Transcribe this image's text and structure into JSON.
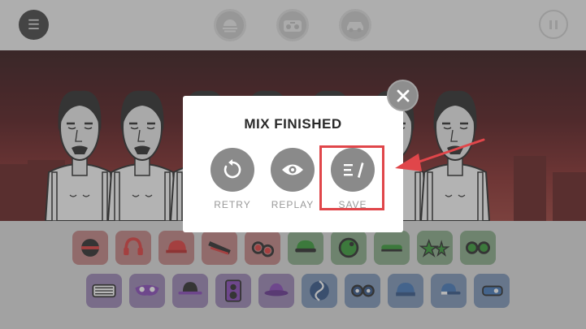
{
  "topbar": {
    "menu_icon": "hamburger-icon",
    "modes": [
      {
        "icon": "sunset-icon"
      },
      {
        "icon": "boombox-icon"
      },
      {
        "icon": "car-icon"
      }
    ],
    "pause_icon": "pause-icon"
  },
  "scene": {
    "characters": 7,
    "colors": {
      "sky_top": "#2a0d0f",
      "sky_bottom": "#8e3530",
      "building": "#5a1a1a"
    }
  },
  "palette": {
    "row1": [
      {
        "icon": "helmet-icon",
        "group": "red"
      },
      {
        "icon": "headphones-icon",
        "group": "red"
      },
      {
        "icon": "cap-icon",
        "group": "red"
      },
      {
        "icon": "sunglasses-icon",
        "group": "red"
      },
      {
        "icon": "round-glasses-icon",
        "group": "red"
      },
      {
        "icon": "green-cap-icon",
        "group": "green"
      },
      {
        "icon": "green-ball-icon",
        "group": "green"
      },
      {
        "icon": "green-headband-icon",
        "group": "green"
      },
      {
        "icon": "star-glasses-icon",
        "group": "green"
      },
      {
        "icon": "goggles-icon",
        "group": "green"
      }
    ],
    "row2": [
      {
        "icon": "shutter-glasses-icon",
        "group": "purple"
      },
      {
        "icon": "mask-icon",
        "group": "purple"
      },
      {
        "icon": "bowler-hat-icon",
        "group": "purple"
      },
      {
        "icon": "speaker-icon",
        "group": "purple"
      },
      {
        "icon": "fedora-icon",
        "group": "purple"
      },
      {
        "icon": "swirl-icon",
        "group": "blue"
      },
      {
        "icon": "blue-glasses-icon",
        "group": "blue"
      },
      {
        "icon": "blue-beanie-icon",
        "group": "blue"
      },
      {
        "icon": "blue-cap-icon",
        "group": "blue"
      },
      {
        "icon": "blue-visor-icon",
        "group": "blue"
      }
    ]
  },
  "dialog": {
    "title": "MIX FINISHED",
    "close_icon": "close-icon",
    "actions": [
      {
        "label": "RETRY",
        "icon": "retry-icon"
      },
      {
        "label": "REPLAY",
        "icon": "eye-icon"
      },
      {
        "label": "SAVE",
        "icon": "save-icon"
      }
    ],
    "highlight_color": "#e0464a"
  }
}
